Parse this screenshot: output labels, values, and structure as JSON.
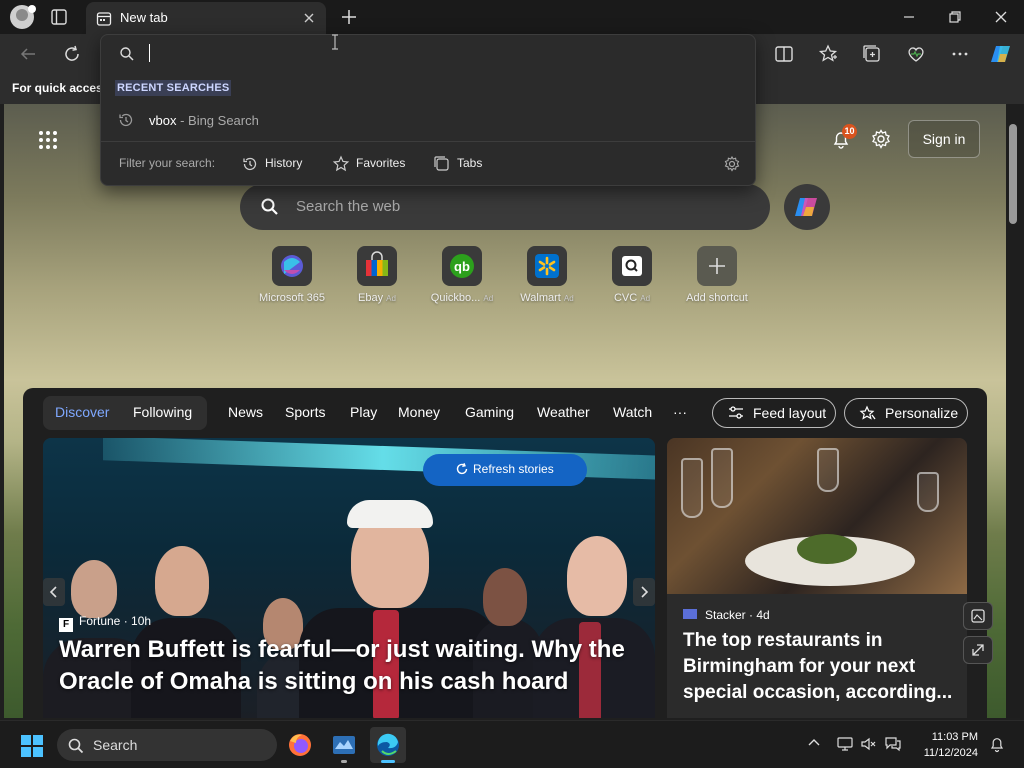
{
  "browser": {
    "tab_title": "New tab",
    "favorites_bar_text": "For quick access"
  },
  "dropdown": {
    "heading": "RECENT SEARCHES",
    "recent": [
      {
        "query": "vbox",
        "suffix": " - Bing Search"
      }
    ],
    "filter_label": "Filter your search:",
    "filters": [
      {
        "label": "History",
        "icon": "history-icon"
      },
      {
        "label": "Favorites",
        "icon": "star-icon"
      },
      {
        "label": "Tabs",
        "icon": "tabs-icon"
      }
    ]
  },
  "newtab": {
    "notification_count": "10",
    "signin_label": "Sign in",
    "search_placeholder": "Search the web",
    "shortcuts": [
      {
        "label": "Microsoft 365",
        "ad": ""
      },
      {
        "label": "Ebay",
        "ad": "Ad"
      },
      {
        "label": "Quickbo...",
        "ad": "Ad"
      },
      {
        "label": "Walmart",
        "ad": "Ad"
      },
      {
        "label": "CVC",
        "ad": "Ad"
      },
      {
        "label": "Add shortcut",
        "ad": ""
      }
    ]
  },
  "feed": {
    "pills": [
      "Discover",
      "Following"
    ],
    "nav": [
      "News",
      "Sports",
      "Play",
      "Money",
      "Gaming",
      "Weather",
      "Watch",
      "···"
    ],
    "feed_layout_label": "Feed layout",
    "personalize_label": "Personalize",
    "refresh_label": "Refresh stories",
    "main_card": {
      "source": "Fortune",
      "age": "10h",
      "title": "Warren Buffett is fearful—or just waiting. Why the Oracle of Omaha is sitting on his cash hoard"
    },
    "side_card": {
      "source": "Stacker",
      "age": "4d",
      "title": "The top restaurants in Birmingham for your next special occasion, according..."
    }
  },
  "taskbar": {
    "search_label": "Search",
    "time": "11:03 PM",
    "date": "11/12/2024"
  },
  "colors": {
    "accent": "#1464c4",
    "badge": "#d9531e"
  }
}
